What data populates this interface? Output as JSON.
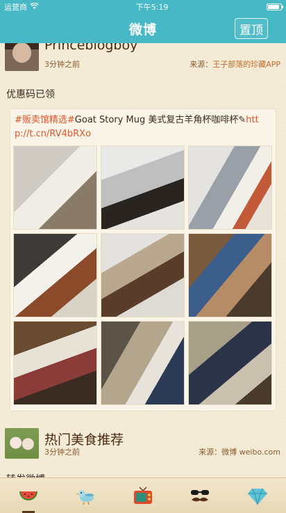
{
  "status_bar": {
    "carrier": "运营商",
    "time": "下午5:19",
    "battery_level": 0.9
  },
  "nav": {
    "title": "微博",
    "top_button_label": "置顶"
  },
  "posts": [
    {
      "username": "Princeblogboy",
      "time": "3分钟之前",
      "source_prefix": "来源：",
      "source_name": "王子部落的珍藏APP",
      "text": "优惠码已领",
      "repost": {
        "hashtag": "#贩卖馆精选#",
        "body": "Goat Story Mug 美式复古羊角杯咖啡杯",
        "link_glyph": "✎",
        "link": "http://t.cn/RV4bRXo"
      },
      "photo_count": 9
    },
    {
      "username": "热门美食推荐",
      "time": "3分钟之前",
      "source_prefix": "来源：",
      "source_name": "微博 weibo.com",
      "text": "转发微博"
    }
  ],
  "tabs": [
    {
      "name": "watermelon-icon",
      "active": true
    },
    {
      "name": "bird-icon",
      "active": false
    },
    {
      "name": "tv-icon",
      "active": false
    },
    {
      "name": "mustache-glasses-icon",
      "active": false
    },
    {
      "name": "diamond-icon",
      "active": false
    }
  ],
  "colors": {
    "nav_bg": "#46b8c6",
    "page_bg": "#f5ecd7",
    "link": "#e2532a",
    "username": "#4a2a14"
  }
}
